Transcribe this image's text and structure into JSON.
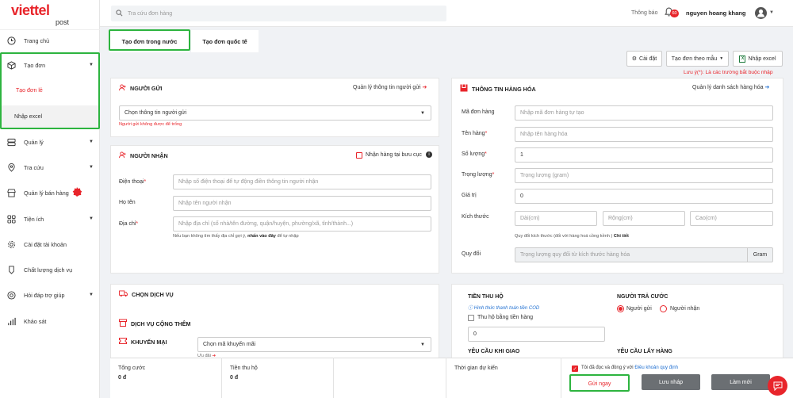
{
  "brand": {
    "logo_top": "viettel",
    "logo_bottom": "post"
  },
  "header": {
    "search_placeholder": "Tra cứu đơn hàng",
    "notify_label": "Thông báo",
    "notify_count": "60",
    "username": "nguyen hoang khang"
  },
  "sidebar": {
    "items": [
      {
        "label": "Trang chủ",
        "icon": "clock-icon"
      },
      {
        "label": "Tạo đơn",
        "icon": "box-icon"
      },
      {
        "label": "Tạo đơn lẻ"
      },
      {
        "label": "Nhập excel"
      },
      {
        "label": "Quản lý",
        "icon": "list-icon"
      },
      {
        "label": "Tra cứu",
        "icon": "pin-icon"
      },
      {
        "label": "Quản lý bán hàng",
        "icon": "store-icon"
      },
      {
        "label": "Tiện ích",
        "icon": "grid-icon"
      },
      {
        "label": "Cài đặt tài khoản",
        "icon": "gear-icon"
      },
      {
        "label": "Chất lượng dịch vụ",
        "icon": "quality-icon"
      },
      {
        "label": "Hỏi đáp trợ giúp",
        "icon": "help-icon"
      },
      {
        "label": "Khảo sát",
        "icon": "chart-icon"
      }
    ]
  },
  "tabs": {
    "domestic": "Tạo đơn trong nước",
    "international": "Tạo đơn quốc tế"
  },
  "toolbar": {
    "settings": "Cài đặt",
    "template": "Tạo đơn theo mẫu",
    "import_excel": "Nhập excel",
    "note": "Lưu ý(*): Là các trường bắt buộc nhập"
  },
  "sender": {
    "title": "NGƯỜI GỬI",
    "manage_link": "Quản lý thông tin người gửi",
    "select_value": "Chọn thông tin người gửi",
    "error": "Người gửi không được để trống"
  },
  "receiver": {
    "title": "NGƯỜI NHẬN",
    "pickup_label": "Nhận hàng tại bưu cục",
    "phone_label": "Điện thoại",
    "phone_placeholder": "Nhập số điện thoại để tự động điền thông tin người nhận",
    "name_label": "Họ tên",
    "name_placeholder": "Nhập tên người nhận",
    "address_label": "Địa chỉ",
    "address_placeholder": "Nhập địa chỉ (số nhà/tên đường, quận/huyện, phường/xã, tỉnh/thành...)",
    "address_hint_pre": "Nếu bạn không tìm thấy địa chỉ gợi ý,",
    "address_hint_link": "nhấn vào đây",
    "address_hint_post": "để tự nhập"
  },
  "service": {
    "title": "CHỌN DỊCH VỤ",
    "addon_title": "DỊCH VỤ CỘNG THÊM",
    "promo_label": "KHUYẾN MẠI",
    "promo_value": "Chọn mã khuyến mãi",
    "offers": "Ưu đãi"
  },
  "goods": {
    "title": "THÔNG TIN HÀNG HÓA",
    "manage_link": "Quản lý danh sách hàng hóa",
    "code_label": "Mã đơn hàng",
    "code_placeholder": "Nhập mã đơn hàng tự tạo",
    "name_label": "Tên hàng",
    "name_placeholder": "Nhập tên hàng hóa",
    "qty_label": "Số lượng",
    "qty_value": "1",
    "weight_label": "Trọng lượng",
    "weight_placeholder": "Trọng lượng (gram)",
    "value_label": "Giá trị",
    "value_value": "0",
    "size_label": "Kích thước",
    "length_ph": "Dài(cm)",
    "width_ph": "Rộng(cm)",
    "height_ph": "Cao(cm)",
    "size_hint_pre": "Quy đổi kích thước (đối với hàng hoá cồng kềnh )",
    "size_hint_link": "Chi tiết",
    "convert_label": "Quy đổi",
    "convert_placeholder": "Trọng lượng quy đổi từ kích thước hàng hóa",
    "convert_unit": "Gram"
  },
  "cod": {
    "title": "TIỀN THU HỘ",
    "method_link": "Hình thức thanh toán tiền COD",
    "checkbox_label": "Thu hộ bằng tiền hàng",
    "value": "0",
    "delivery_req": "YÊU CẦU KHI GIAO"
  },
  "payer": {
    "title": "NGƯỜI TRẢ CƯỚC",
    "option_sender": "Người gửi",
    "option_receiver": "Người nhận",
    "pickup_req": "YÊU CẦU LẤY HÀNG"
  },
  "footer": {
    "total_label": "Tổng cước",
    "total_value": "0 đ",
    "cod_label": "Tiền thu hộ",
    "cod_value": "0 đ",
    "eta_label": "Thời gian dự kiến",
    "agree_text": "Tôi đã đọc và đồng ý với",
    "terms_link": "Điều khoản quy định",
    "send_now": "Gửi ngay",
    "save_draft": "Lưu nháp",
    "reset": "Làm mới"
  },
  "colors": {
    "brand_red": "#e8252b",
    "highlight_green": "#2db43f",
    "dark_button": "#6b6f73",
    "link_blue": "#1f6fd1"
  }
}
